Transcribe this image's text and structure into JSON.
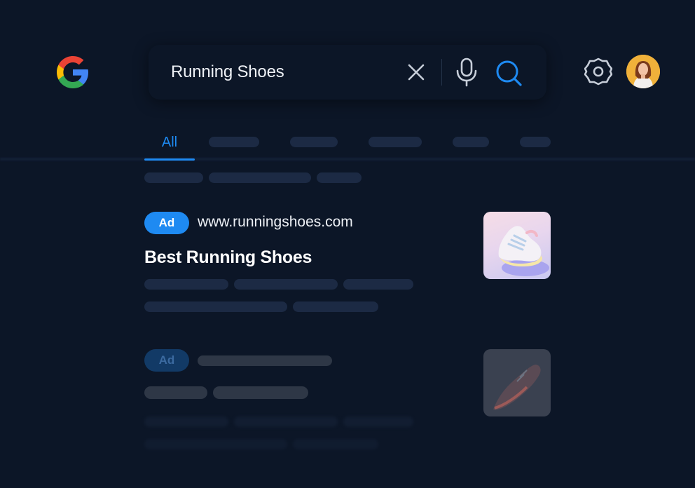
{
  "search": {
    "query": "Running Shoes"
  },
  "icons": {
    "logo": "google-logo",
    "clear": "close-icon",
    "mic": "microphone-icon",
    "search": "search-icon",
    "settings": "gear-icon",
    "avatar": "user-avatar"
  },
  "tabs": {
    "active_label": "All"
  },
  "results": [
    {
      "badge": "Ad",
      "url": "www.runningshoes.com",
      "title": "Best Running Shoes"
    },
    {
      "badge": "Ad"
    }
  ],
  "colors": {
    "background": "#0c1627",
    "accent": "#1e8af2",
    "placeholder": "#1c2a44"
  }
}
